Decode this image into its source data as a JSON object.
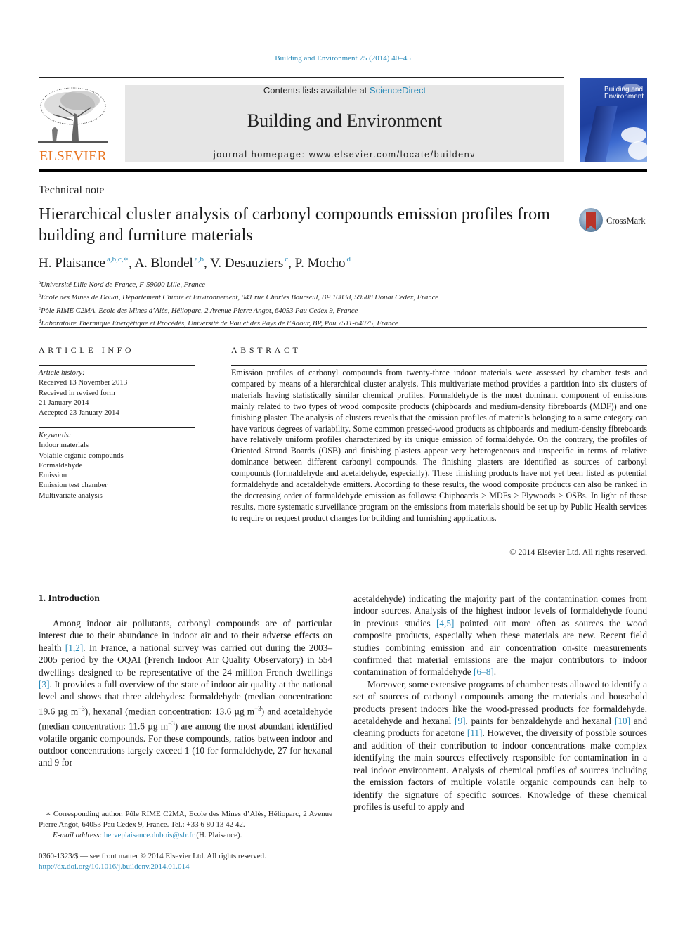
{
  "running_head": "Building and Environment 75 (2014) 40–45",
  "publisher": {
    "logo_word": "ELSEVIER",
    "contents_prefix": "Contents lists available at ",
    "contents_link": "ScienceDirect",
    "journal_name": "Building and Environment",
    "homepage": "journal homepage: www.elsevier.com/locate/buildenv",
    "cover_title_line1": "Building and",
    "cover_title_line2": "Environment"
  },
  "colors": {
    "link": "#2a8ab8",
    "elsevier_orange": "#e8731e",
    "masthead_grey": "#e6e6e6"
  },
  "article": {
    "section_type": "Technical note",
    "title": "Hierarchical cluster analysis of carbonyl compounds emission profiles from building and furniture materials",
    "crossmark_label": "CrossMark",
    "authors": [
      {
        "name": "H. Plaisance",
        "sup": "a,b,c,∗",
        "sep": ", "
      },
      {
        "name": "A. Blondel",
        "sup": "a,b",
        "sep": ", "
      },
      {
        "name": "V. Desauziers",
        "sup": "c",
        "sep": ", "
      },
      {
        "name": "P. Mocho",
        "sup": "d",
        "sep": ""
      }
    ],
    "affiliations": [
      {
        "key": "a",
        "text": "Université Lille Nord de France, F-59000 Lille, France"
      },
      {
        "key": "b",
        "text": "Ecole des Mines de Douai, Département Chimie et Environnement, 941 rue Charles Bourseul, BP 10838, 59508 Douai Cedex, France"
      },
      {
        "key": "c",
        "text": "Pôle RIME C2MA, Ecole des Mines d’Alès, Hélioparc, 2 Avenue Pierre Angot, 64053 Pau Cedex 9, France"
      },
      {
        "key": "d",
        "text": "Laboratoire Thermique Energétique et Procédés, Université de Pau et des Pays de l’Adour, BP, Pau 7511-64075, France"
      }
    ]
  },
  "article_info": {
    "heading": "ARTICLE INFO",
    "history_label": "Article history:",
    "history": [
      "Received 13 November 2013",
      "Received in revised form",
      "21 January 2014",
      "Accepted 23 January 2014"
    ],
    "keywords_label": "Keywords:",
    "keywords": [
      "Indoor materials",
      "Volatile organic compounds",
      "Formaldehyde",
      "Emission",
      "Emission test chamber",
      "Multivariate analysis"
    ]
  },
  "abstract": {
    "heading": "ABSTRACT",
    "text": "Emission profiles of carbonyl compounds from twenty-three indoor materials were assessed by chamber tests and compared by means of a hierarchical cluster analysis. This multivariate method provides a partition into six clusters of materials having statistically similar chemical profiles. Formaldehyde is the most dominant component of emissions mainly related to two types of wood composite products (chipboards and medium-density fibreboards (MDF)) and one finishing plaster. The analysis of clusters reveals that the emission profiles of materials belonging to a same category can have various degrees of variability. Some common pressed-wood products as chipboards and medium-density fibreboards have relatively uniform profiles characterized by its unique emission of formaldehyde. On the contrary, the profiles of Oriented Strand Boards (OSB) and finishing plasters appear very heterogeneous and unspecific in terms of relative dominance between different carbonyl compounds. The finishing plasters are identified as sources of carbonyl compounds (formaldehyde and acetaldehyde, especially). These finishing products have not yet been listed as potential formaldehyde and acetaldehyde emitters. According to these results, the wood composite products can also be ranked in the decreasing order of formaldehyde emission as follows: Chipboards > MDFs > Plywoods > OSBs. In light of these results, more systematic surveillance program on the emissions from materials should be set up by Public Health services to require or request product changes for building and furnishing applications.",
    "copyright": "© 2014 Elsevier Ltd. All rights reserved."
  },
  "introduction": {
    "heading": "1.  Introduction",
    "left_p1": [
      {
        "t": "Among indoor air pollutants, carbonyl compounds are of particular interest due to their abundance in indoor air and to their adverse effects on health "
      },
      {
        "ref": "[1,2]"
      },
      {
        "t": ". In France, a national survey was carried out during the 2003–2005 period by the OQAI (French Indoor Air Quality Observatory) in 554 dwellings designed to be representative of the 24 million French dwellings "
      },
      {
        "ref": "[3]"
      },
      {
        "t": ". It provides a full overview of the state of indoor air quality at the national level and shows that three aldehydes: formaldehyde (median concentration: 19.6 µg m"
      },
      {
        "sup": "−3"
      },
      {
        "t": "), hexanal (median concentration: 13.6 µg m"
      },
      {
        "sup": "−3"
      },
      {
        "t": ") and acetaldehyde (median concentration: 11.6 µg m"
      },
      {
        "sup": "−3"
      },
      {
        "t": ") are among the most abundant identified volatile organic compounds. For these compounds, ratios between indoor and outdoor concentrations largely exceed 1 (10 for formaldehyde, 27 for hexanal and 9 for"
      }
    ],
    "right_p1": [
      {
        "t": "acetaldehyde) indicating the majority part of the contamination comes from indoor sources. Analysis of the highest indoor levels of formaldehyde found in previous studies "
      },
      {
        "ref": "[4,5]"
      },
      {
        "t": " pointed out more often as sources the wood composite products, especially when these materials are new. Recent field studies combining emission and air concentration on-site measurements confirmed that material emissions are the major contributors to indoor contamination of formaldehyde "
      },
      {
        "ref": "[6–8]"
      },
      {
        "t": "."
      }
    ],
    "right_p2": [
      {
        "t": "Moreover, some extensive programs of chamber tests allowed to identify a set of sources of carbonyl compounds among the materials and household products present indoors like the wood-pressed products for formaldehyde, acetaldehyde and hexanal "
      },
      {
        "ref": "[9]"
      },
      {
        "t": ", paints for benzaldehyde and hexanal "
      },
      {
        "ref": "[10]"
      },
      {
        "t": " and cleaning products for acetone "
      },
      {
        "ref": "[11]"
      },
      {
        "t": ". However, the diversity of possible sources and addition of their contribution to indoor concentrations make complex identifying the main sources effectively responsible for contamination in a real indoor environment. Analysis of chemical profiles of sources including the emission factors of multiple volatile organic compounds can help to identify the signature of specific sources. Knowledge of these chemical profiles is useful to apply and"
      }
    ]
  },
  "footnote": {
    "corresponding": "∗ Corresponding author. Pôle RIME C2MA, Ecole des Mines d’Alès, Hélioparc, 2 Avenue Pierre Angot, 64053 Pau Cedex 9, France. Tel.: +33 6 80 13 42 42.",
    "email_label": "E-mail address:",
    "email": "herveplaisance.dubois@sfr.fr",
    "email_owner": " (H. Plaisance)."
  },
  "front_matter": {
    "issn_line": "0360-1323/$ — see front matter © 2014 Elsevier Ltd. All rights reserved.",
    "doi": "http://dx.doi.org/10.1016/j.buildenv.2014.01.014"
  }
}
